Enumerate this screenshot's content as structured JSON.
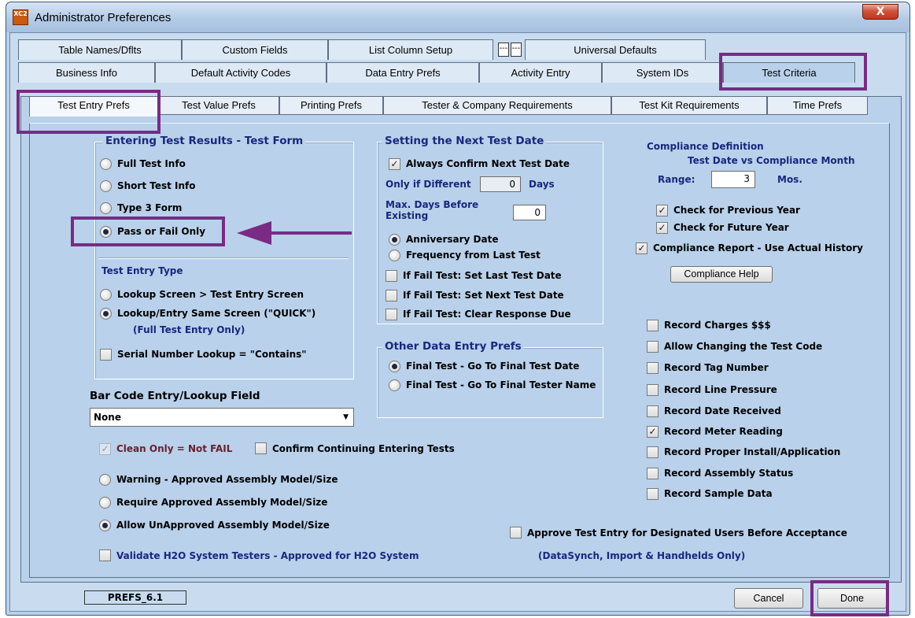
{
  "window": {
    "title": "Administrator Preferences",
    "icon_text": "XC2",
    "close_glyph": "X"
  },
  "top_tabs_row1": [
    "Table Names/Dflts",
    "Custom Fields",
    "List Column Setup",
    "Universal Defaults"
  ],
  "small_tab_labels": [
    "---",
    "---"
  ],
  "top_tabs_row2": [
    "Business Info",
    "Default Activity Codes",
    "Data Entry Prefs",
    "Activity Entry",
    "System IDs",
    "Test Criteria"
  ],
  "inner_tabs": [
    "Test Entry Prefs",
    "Test Value Prefs",
    "Printing Prefs",
    "Tester & Company Requirements",
    "Test Kit Requirements",
    "Time Prefs"
  ],
  "entering_results": {
    "title": "Entering Test Results - Test Form",
    "options": [
      "Full Test Info",
      "Short Test Info",
      "Type 3 Form",
      "Pass or Fail Only"
    ],
    "selected": "Pass or Fail Only",
    "entry_type_title": "Test Entry Type",
    "entry_type_options": [
      "Lookup Screen > Test Entry Screen",
      "Lookup/Entry Same Screen (\"QUICK\")"
    ],
    "entry_type_note": "(Full Test Entry Only)",
    "serial_lookup_label": "Serial Number Lookup = \"Contains\"",
    "serial_lookup_checked": false
  },
  "bar_code": {
    "label": "Bar Code Entry/Lookup Field",
    "value": "None"
  },
  "clean_only": {
    "label": "Clean Only = Not FAIL",
    "checked": true
  },
  "confirm_continuing": {
    "label": "Confirm Continuing Entering Tests",
    "checked": false
  },
  "assembly_options": [
    "Warning - Approved Assembly Model/Size",
    "Require Approved Assembly Model/Size",
    "Allow UnApproved Assembly Model/Size"
  ],
  "validate_h2o": {
    "label": "Validate H2O System Testers - Approved for H2O System",
    "checked": false
  },
  "next_test_date": {
    "title": "Setting the Next Test Date",
    "always_confirm_label": "Always Confirm Next Test Date",
    "always_confirm_checked": true,
    "only_if_different_label": "Only if Different",
    "only_if_different_value": "0",
    "days_label": "Days",
    "max_days_label_1": "Max. Days Before",
    "max_days_label_2": "Existing",
    "max_days_value": "0",
    "radio_options": [
      "Anniversary Date",
      "Frequency from Last Test"
    ],
    "fail_options": [
      "If Fail Test:  Set Last Test Date",
      "If Fail Test:  Set Next Test Date",
      "If Fail Test:  Clear Response Due"
    ]
  },
  "other_prefs": {
    "title": "Other Data Entry Prefs",
    "options": [
      "Final Test - Go To Final Test Date",
      "Final Test - Go To Final Tester Name"
    ]
  },
  "compliance": {
    "title": "Compliance Definition",
    "subtitle": "Test Date vs Compliance Month",
    "range_label": "Range:",
    "range_value": "3",
    "mos_label": "Mos.",
    "check_prev_label": "Check for Previous Year",
    "check_future_label": "Check for Future Year",
    "report_label": "Compliance Report - Use Actual History",
    "help_button": "Compliance Help"
  },
  "record_options": [
    {
      "label": "Record Charges $$$",
      "checked": false
    },
    {
      "label": "Allow Changing the Test Code",
      "checked": false
    },
    {
      "label": "Record Tag Number",
      "checked": false
    },
    {
      "label": "Record Line Pressure",
      "checked": false
    },
    {
      "label": "Record Date Received",
      "checked": false
    },
    {
      "label": "Record Meter Reading",
      "checked": true
    },
    {
      "label": "Record Proper Install/Application",
      "checked": false
    },
    {
      "label": "Record Assembly Status",
      "checked": false
    },
    {
      "label": "Record Sample Data",
      "checked": false
    }
  ],
  "approve_entry": {
    "label": "Approve Test Entry for Designated Users Before Acceptance",
    "note": "(DataSynch, Import & Handhelds Only)"
  },
  "footer": {
    "prefs_id": "PREFS_6.1",
    "cancel": "Cancel",
    "done": "Done"
  },
  "colors": {
    "highlight": "#7a2b84",
    "group_title": "#1a2680",
    "panel_bg": "#b9d1ea"
  }
}
